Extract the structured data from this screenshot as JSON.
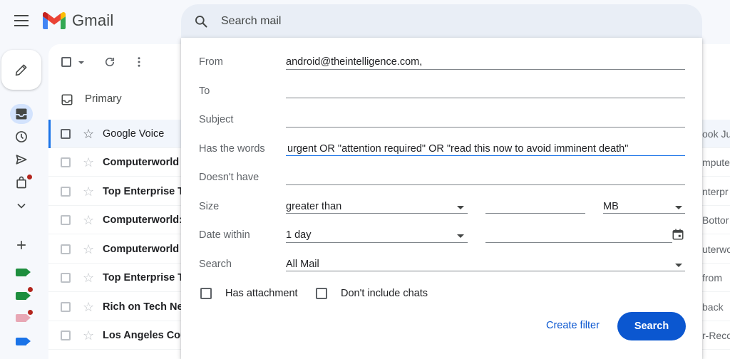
{
  "app": {
    "name": "Gmail"
  },
  "search": {
    "placeholder": "Search mail"
  },
  "tabs": {
    "primary": "Primary"
  },
  "rows": [
    {
      "sender": "Google Voice",
      "snippet": "ook Ju"
    },
    {
      "sender": "Computerworld",
      "snippet": "mputer"
    },
    {
      "sender": "Top Enterprise T",
      "snippet": "nterpr"
    },
    {
      "sender": "Computerworld:",
      "snippet": "Bottor"
    },
    {
      "sender": "Computerworld",
      "snippet": "uterwo"
    },
    {
      "sender": "Top Enterprise T",
      "snippet": "from"
    },
    {
      "sender": "Rich on Tech Ne",
      "snippet": "back"
    },
    {
      "sender": "Los Angeles Cou",
      "snippet": "r-Reco"
    }
  ],
  "advanced_search": {
    "labels": {
      "from": "From",
      "to": "To",
      "subject": "Subject",
      "has_words": "Has the words",
      "doesnt_have": "Doesn't have",
      "size": "Size",
      "date_within": "Date within",
      "search": "Search"
    },
    "values": {
      "from": "android@theintelligence.com,",
      "to": "",
      "subject": "",
      "has_words": "urgent OR \"attention required\" OR \"read this now to avoid imminent death\"",
      "doesnt_have": "",
      "size_operator": "greater than",
      "size_value": "",
      "size_unit": "MB",
      "date_within": "1 day",
      "date": "",
      "search_in": "All Mail"
    },
    "checkboxes": {
      "has_attachment": "Has attachment",
      "dont_include_chats": "Don't include chats"
    },
    "buttons": {
      "create_filter": "Create filter",
      "search": "Search"
    }
  },
  "colors": {
    "accent": "#0b57d0",
    "background": "#f6f8fc",
    "search_bar": "#e9eef6",
    "unread_dot": "#b3261e",
    "label_green": "#1e8e3e",
    "label_pink": "#e8a7b5",
    "label_blue": "#1a73e8"
  }
}
